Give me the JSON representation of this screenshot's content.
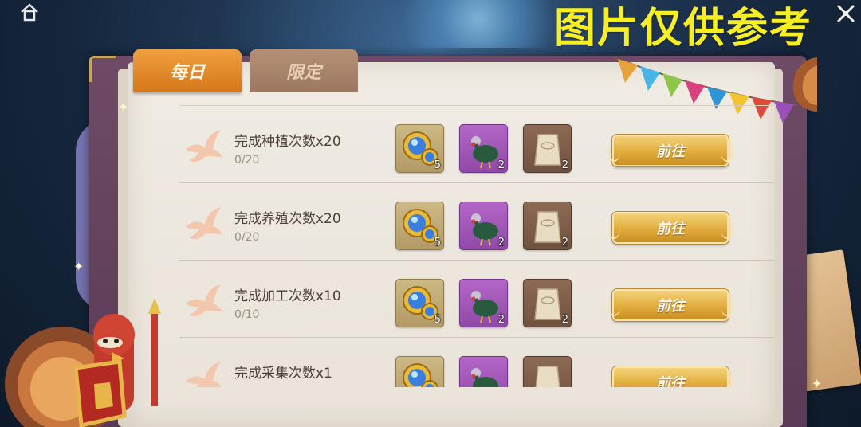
{
  "watermark": "图片仅供参考",
  "tabs": [
    {
      "label": "每日",
      "active": true
    },
    {
      "label": "限定",
      "active": false
    }
  ],
  "tasks": [
    {
      "title": "完成种植次数x20",
      "progress": "0/20",
      "rewards": [
        {
          "icon": "gold-gem-coin-icon",
          "count": "5"
        },
        {
          "icon": "turkey-icon",
          "count": "2"
        },
        {
          "icon": "feed-sack-icon",
          "count": "2"
        }
      ],
      "button": "前往"
    },
    {
      "title": "完成养殖次数x20",
      "progress": "0/20",
      "rewards": [
        {
          "icon": "gold-gem-coin-icon",
          "count": "5"
        },
        {
          "icon": "turkey-icon",
          "count": "2"
        },
        {
          "icon": "feed-sack-icon",
          "count": "2"
        }
      ],
      "button": "前往"
    },
    {
      "title": "完成加工次数x10",
      "progress": "0/10",
      "rewards": [
        {
          "icon": "gold-gem-coin-icon",
          "count": "5"
        },
        {
          "icon": "turkey-icon",
          "count": "2"
        },
        {
          "icon": "feed-sack-icon",
          "count": "2"
        }
      ],
      "button": "前往"
    },
    {
      "title": "完成采集次数x1",
      "progress": "",
      "rewards": [
        {
          "icon": "gold-gem-coin-icon",
          "count": ""
        },
        {
          "icon": "turkey-icon",
          "count": ""
        },
        {
          "icon": "feed-sack-icon",
          "count": ""
        }
      ],
      "button": "前往"
    }
  ],
  "colors": {
    "tab_active": "#e38a2a",
    "tab_inactive": "#a9846a",
    "button_gold": "#e2ac3c",
    "watermark": "#f7ef22",
    "reward_purple": "#9c52b4"
  }
}
